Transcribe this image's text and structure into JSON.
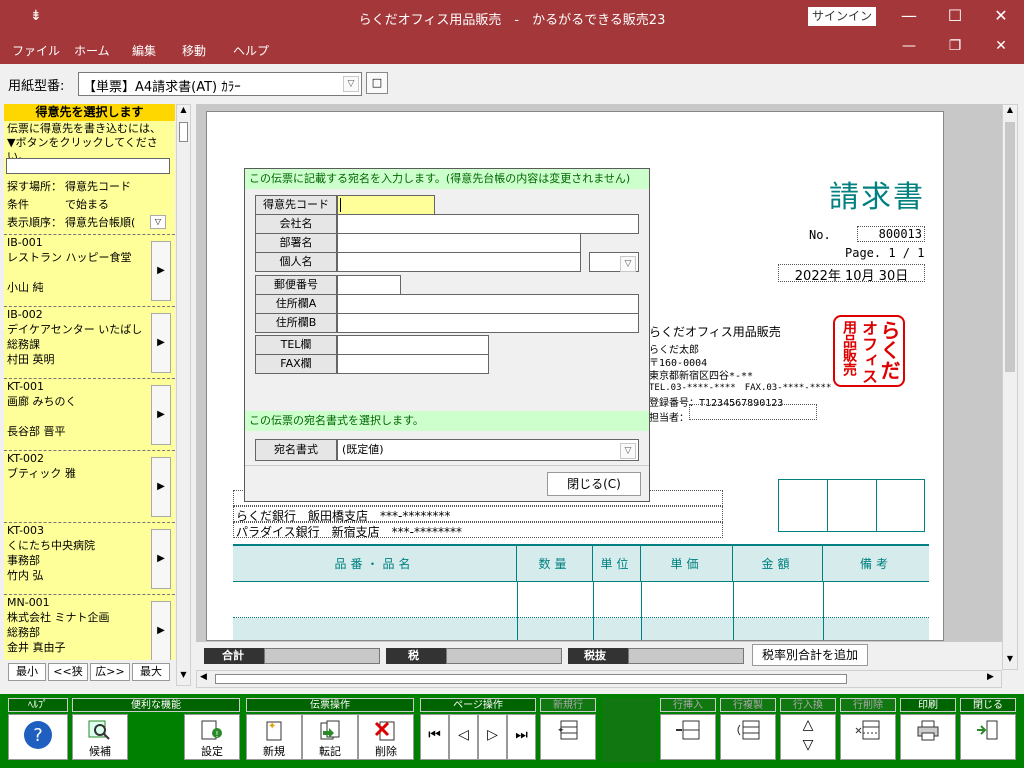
{
  "window": {
    "title": "らくだオフィス用品販売　-　かるがるできる販売23",
    "signin": "サインイン"
  },
  "menu": [
    "ファイル",
    "ホーム",
    "編集",
    "移動",
    "ヘルプ"
  ],
  "form": {
    "label": "用紙型番:",
    "value": "【単票】A4請求書(AT) ｶﾗｰ"
  },
  "sidebar": {
    "header": "得意先を選択します",
    "hint1": "伝票に得意先を書き込むには、",
    "hint2": "▼ボタンをクリックしてください。",
    "search_label": "探す場所：",
    "search_value": "得意先コード",
    "cond_label": "条件",
    "cond_value": "で始まる",
    "order_label": "表示順序：",
    "order_value": "得意先台帳順(",
    "customers": [
      {
        "code": "IB-001",
        "name": "レストラン ハッピー食堂",
        "dept": "",
        "person": "小山 純"
      },
      {
        "code": "IB-002",
        "name": "デイケアセンター いたばし",
        "dept": "総務課",
        "person": "村田 英明"
      },
      {
        "code": "KT-001",
        "name": "画廊 みちのく",
        "dept": "",
        "person": "長谷部 晋平"
      },
      {
        "code": "KT-002",
        "name": "ブティック 雅",
        "dept": "",
        "person": ""
      },
      {
        "code": "KT-003",
        "name": "くにたち中央病院",
        "dept": "事務部",
        "person": "竹内 弘"
      },
      {
        "code": "MN-001",
        "name": "株式会社 ミナト企画",
        "dept": "総務部",
        "person": "金井 真由子"
      }
    ],
    "zoom": [
      "最小",
      "<<狭",
      "広>>",
      "最大"
    ]
  },
  "doc": {
    "title": "請求書",
    "no_label": "No.",
    "no": "800013",
    "page": "Page. 1 / 1",
    "date": "2022年 10月 30日",
    "company": "らくだオフィス用品販売",
    "rep": "らくだ太郎",
    "zip": "〒160-0004",
    "addr": "東京都新宿区四谷*-**",
    "tel": "TEL.03-****-****　FAX.03-****-****",
    "reg": "登録番号：T1234567890123",
    "staff": "担当者：",
    "seal": "らくだオフィス用品販売",
    "banks": [
      "らくだ銀行　飯田橋支店　***-********",
      "パラダイス銀行　新宿支店　***-********"
    ],
    "headers": [
      "品番・品名",
      "数量",
      "単位",
      "単価",
      "金額",
      "備考"
    ]
  },
  "dialog": {
    "bar1": "この伝票に記載する宛名を入力します。(得意先台帳の内容は変更されません)",
    "fields": [
      "得意先コード",
      "会社名",
      "部署名",
      "個人名",
      "郵便番号",
      "住所欄A",
      "住所欄B",
      "TEL欄",
      "FAX欄"
    ],
    "bar2": "この伝票の宛名書式を選択します。",
    "format_label": "宛名書式",
    "format_value": "(既定値)",
    "close": "閉じる(C)"
  },
  "totals": {
    "subtotal": "合計",
    "tax": "税",
    "excl": "税抜",
    "add_button": "税率別合計を追加"
  },
  "toolbar": {
    "groups": [
      "ﾍﾙﾌﾟ",
      "便利な機能",
      "伝票操作",
      "ページ操作",
      "新規行",
      "行挿入",
      "行複製",
      "行入換",
      "行削除",
      "印刷",
      "閉じる"
    ],
    "buttons": [
      "候補",
      "設定",
      "新規",
      "転記",
      "削除"
    ]
  }
}
